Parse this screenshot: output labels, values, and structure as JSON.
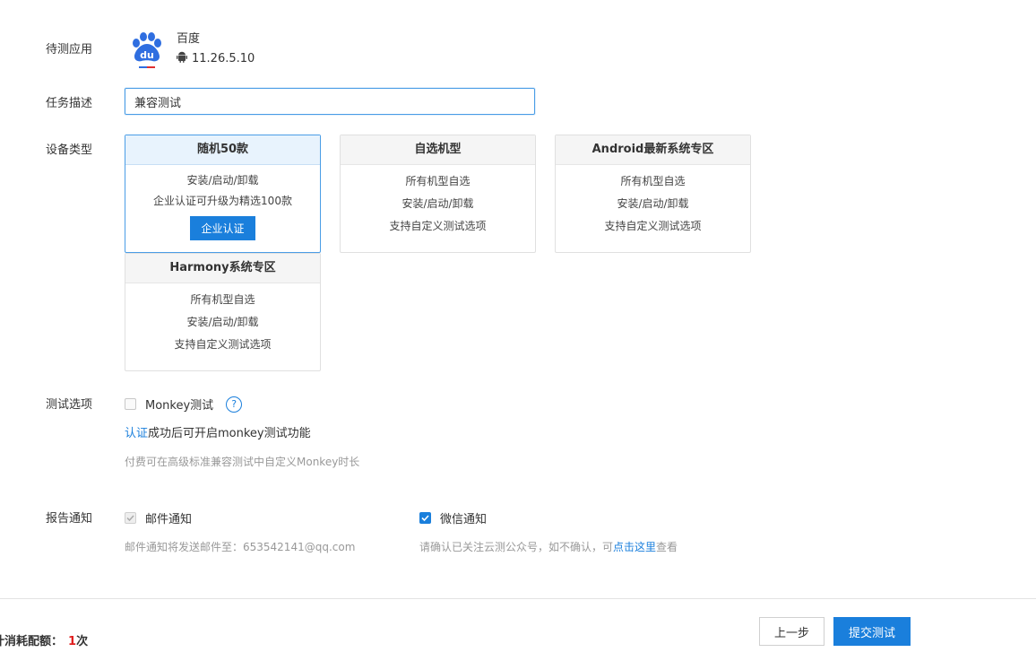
{
  "form": {
    "app_label": "待测应用",
    "desc_label": "任务描述",
    "device_label": "设备类型",
    "options_label": "测试选项",
    "notify_label": "报告通知"
  },
  "app": {
    "name": "百度",
    "version": "11.26.5.10",
    "icon": "baidu-paw-logo",
    "platform_icon": "android-icon"
  },
  "task": {
    "description": "兼容测试"
  },
  "devices": [
    {
      "title": "随机50款",
      "lines": [
        "安装/启动/卸载",
        "企业认证可升级为精选100款"
      ],
      "button": "企业认证",
      "selected": true
    },
    {
      "title": "自选机型",
      "lines": [
        "所有机型自选",
        "安装/启动/卸载",
        "支持自定义测试选项"
      ]
    },
    {
      "title": "Android最新系统专区",
      "lines": [
        "所有机型自选",
        "安装/启动/卸载",
        "支持自定义测试选项"
      ]
    },
    {
      "title": "Harmony系统专区",
      "lines": [
        "所有机型自选",
        "安装/启动/卸载",
        "支持自定义测试选项"
      ]
    }
  ],
  "options": {
    "monkey_label": "Monkey测试",
    "monkey_checked": false,
    "help_glyph": "?",
    "cert_link": "认证",
    "cert_tail": "成功后可开启monkey测试功能",
    "paid_note": "付费可在高级标准兼容测试中自定义Monkey时长"
  },
  "notify": {
    "email_label": "邮件通知",
    "email_checked": true,
    "email_note": "邮件通知将发送邮件至：653542141@qq.com",
    "wechat_label": "微信通知",
    "wechat_checked": true,
    "wechat_note_pre": "请确认已关注云测公众号，如不确认，可",
    "wechat_link": "点击这里",
    "wechat_note_post": "查看"
  },
  "footer": {
    "quota_label": "计消耗配额：",
    "quota_value": "1",
    "quota_unit": "次",
    "prev_button": "上一步",
    "submit_button": "提交测试"
  },
  "colors": {
    "accent": "#1a7fdc",
    "quota_value": "#e02020"
  }
}
